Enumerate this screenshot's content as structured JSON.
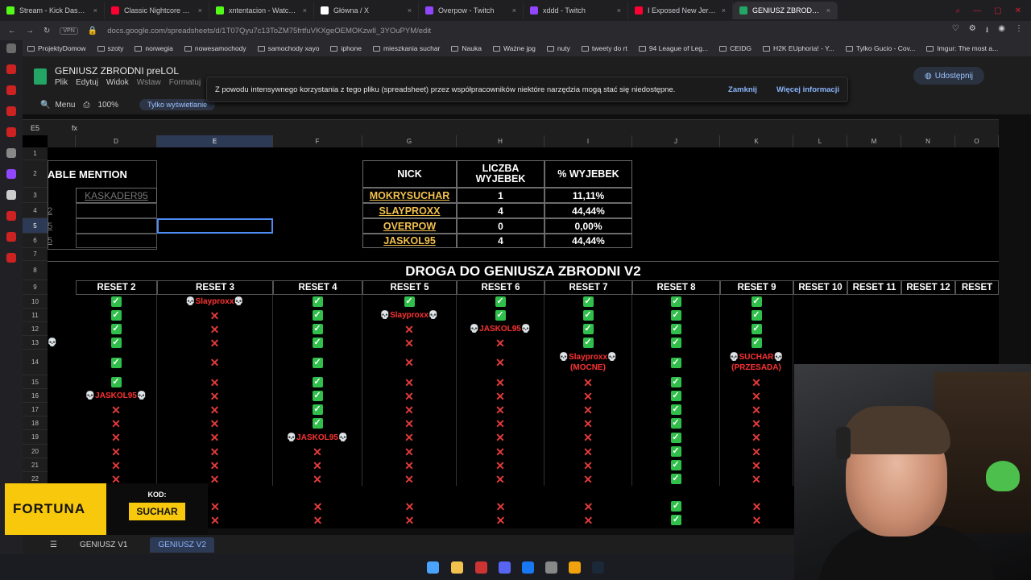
{
  "browser": {
    "tabs": [
      {
        "label": "Stream - Kick Dashboard",
        "color": "#53fc18"
      },
      {
        "label": "Classic Nightcore mix - Yo",
        "color": "#ff0033"
      },
      {
        "label": "xntentacion - Watch the V",
        "color": "#53fc18"
      },
      {
        "label": "Główna / X",
        "color": "#ffffff"
      },
      {
        "label": "Overpow - Twitch",
        "color": "#9146ff"
      },
      {
        "label": "xddd - Twitch",
        "color": "#9146ff"
      },
      {
        "label": "I Exposed New Jersey's J",
        "color": "#ff0033"
      },
      {
        "label": "GENIUSZ ZBRODNI preLO",
        "color": "#23a566"
      }
    ],
    "url": "docs.google.com/spreadsheets/d/1T07Qyu7c13ToZM75frtfuVKXgeOEMOKzwlI_3YOuPYM/edit",
    "vpn": "VPN",
    "bookmarks": [
      "ProjektyDomow",
      "szoty",
      "norwegia",
      "nowesamochody",
      "samochody xayo",
      "iphone",
      "mieszkania suchar",
      "Nauka",
      "Ważne jpg",
      "nuty",
      "tweety do rt",
      "94 League of Leg...",
      "CEIDG",
      "H2K EUphoria! - Y...",
      "Tylko Gucio - Cov...",
      "Imgur: The most a..."
    ]
  },
  "sheets": {
    "title": "GENIUSZ ZBRODNI preLOL",
    "menus": [
      "Plik",
      "Edytuj",
      "Widok",
      "Wstaw",
      "Formatuj"
    ],
    "share_label": "Udostępnij",
    "search_label": "Menu",
    "zoom": "100%",
    "view_only": "Tylko wyświetlanie",
    "cell_ref": "E5",
    "fx": "fx",
    "notice": {
      "text": "Z powodu intensywnego korzystania z tego pliku (spreadsheet) przez współpracowników niektóre narzędzia mogą stać się niedostępne.",
      "close": "Zamknij",
      "more": "Więcej informacji"
    },
    "sheet_tabs": [
      "GENIUSZ V1",
      "GENIUSZ V2"
    ]
  },
  "grid": {
    "columns": [
      "D",
      "E",
      "F",
      "G",
      "H",
      "I",
      "J",
      "K",
      "L",
      "M",
      "N",
      "O"
    ],
    "rows": [
      "1",
      "2",
      "3",
      "4",
      "5",
      "6",
      "7",
      "8",
      "9",
      "10",
      "11",
      "12",
      "13",
      "14",
      "15",
      "16",
      "17",
      "18",
      "19",
      "20",
      "21",
      "22"
    ],
    "honorable": {
      "header": "ABLE MENTION",
      "name": "KASKADER95",
      "row_frags": [
        "2",
        "5",
        "5"
      ]
    },
    "stats": {
      "headers": [
        "NICK",
        "LICZBA WYJEBEK",
        "% WYJEBEK"
      ],
      "rows": [
        {
          "nick": "MOKRYSUCHAR",
          "count": "1",
          "pct": "11,11%"
        },
        {
          "nick": "SLAYPROXX",
          "count": "4",
          "pct": "44,44%"
        },
        {
          "nick": "OVERPOW",
          "count": "0",
          "pct": "0,00%"
        },
        {
          "nick": "JASKOL95",
          "count": "4",
          "pct": "44,44%"
        }
      ]
    },
    "section_title": "DROGA DO GENIUSZA ZBRODNI V2",
    "reset_headers": [
      "RESET 2",
      "RESET 3",
      "RESET 4",
      "RESET 5",
      "RESET 6",
      "RESET 7",
      "RESET 8",
      "RESET 9",
      "RESET 10",
      "RESET 11",
      "RESET 12",
      "RESET"
    ],
    "skull": "💀",
    "checkmark": "✓",
    "cross": "✕",
    "labels": {
      "slayproxx": "Slayproxx",
      "jaskol95": "JASKOL95",
      "slayproxx_mocne": "Slayproxx",
      "mocne": "(MOCNE)",
      "suchar": "SUCHAR",
      "przesada": "(PRZESADA)"
    }
  },
  "sponsor": {
    "brand": "FORTUNA",
    "kod": "KOD:",
    "code": "SUCHAR"
  },
  "colors": {
    "check": "#2fbf4a",
    "cross": "#e23b3b",
    "nick": "#f2c14e",
    "accent": "#8ab4f8"
  }
}
